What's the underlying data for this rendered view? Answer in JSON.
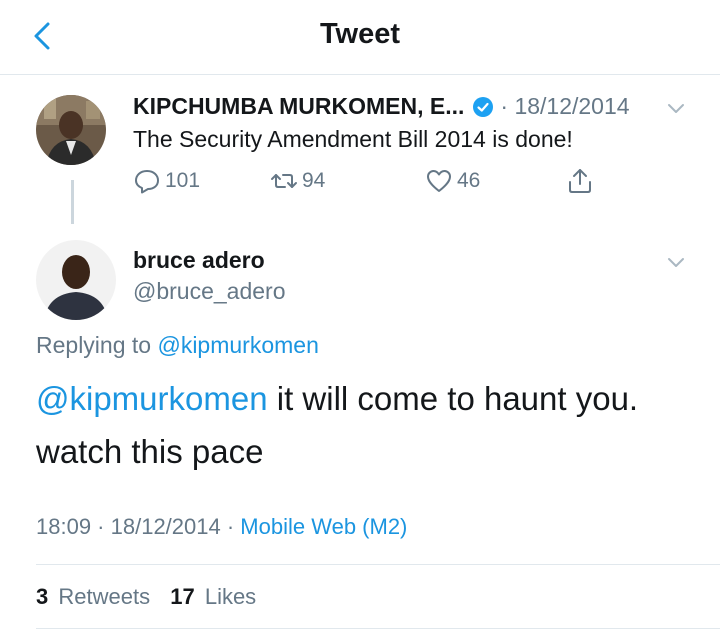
{
  "header": {
    "title": "Tweet"
  },
  "parent_tweet": {
    "name": "KIPCHUMBA MURKOMEN, E...",
    "date": "18/12/2014",
    "text": "The Security Amendment Bill 2014 is done!",
    "replies": "101",
    "retweets": "94",
    "likes": "46"
  },
  "reply_tweet": {
    "name": "bruce adero",
    "handle": "@bruce_adero",
    "replying_prefix": "Replying to",
    "replying_to": "@kipmurkomen",
    "mention": "@kipmurkomen",
    "text_after_mention": " it will come to haunt you. watch this pace",
    "time": "18:09",
    "date": "18/12/2014",
    "source": "Mobile Web (M2)",
    "retweet_count": "3",
    "retweet_label": "Retweets",
    "like_count": "17",
    "like_label": "Likes"
  },
  "colors": {
    "link": "#1b95e0",
    "muted": "#657786",
    "text": "#14171a",
    "divider": "#e1e8ed"
  }
}
